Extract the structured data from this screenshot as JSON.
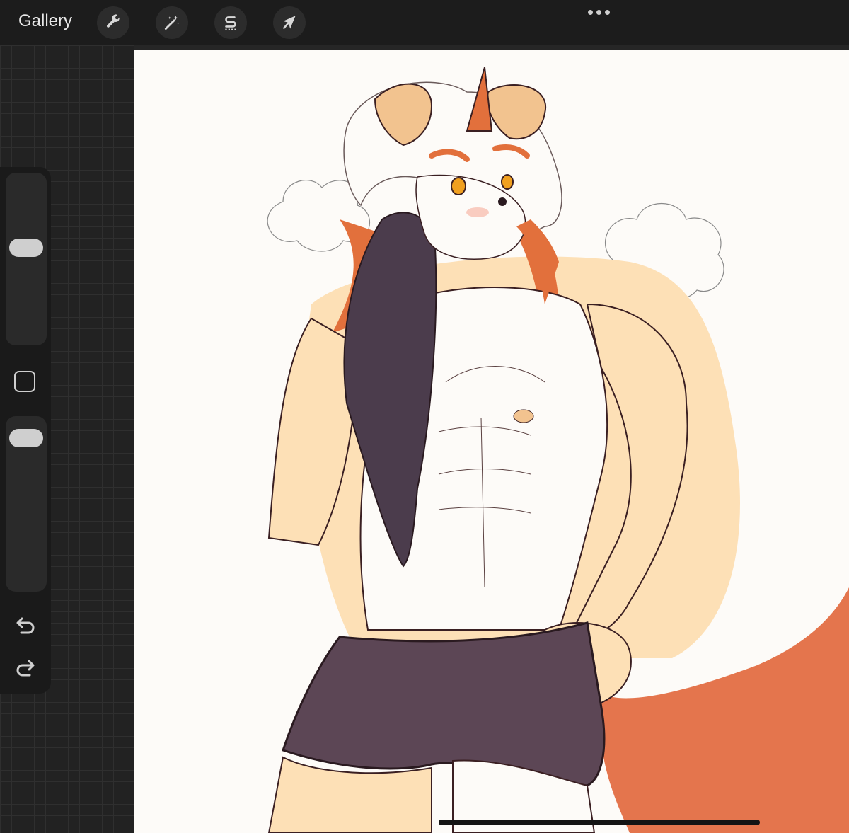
{
  "topbar": {
    "gallery_label": "Gallery",
    "tools": [
      {
        "name": "actions",
        "icon": "wrench-icon"
      },
      {
        "name": "adjustments",
        "icon": "magic-wand-icon"
      },
      {
        "name": "selection",
        "icon": "selection-s-icon"
      },
      {
        "name": "transform",
        "icon": "arrow-cursor-icon"
      }
    ],
    "more_icon": "ellipsis-icon"
  },
  "sidebar": {
    "brush_size_level": 0.42,
    "opacity_level": 0.05,
    "modify_icon": "square-icon",
    "undo_icon": "undo-icon",
    "redo_icon": "redo-icon"
  },
  "canvas": {
    "content": "illustration-sketch",
    "colors": {
      "background": "#fdfbf8",
      "line": "#3a1f22",
      "skin": "#fde0b6",
      "hair_orange": "#e2703c",
      "shorts": "#5c4655",
      "towel": "#4b3c4c",
      "tail": "#e4754d",
      "eye": "#f0a020"
    }
  }
}
